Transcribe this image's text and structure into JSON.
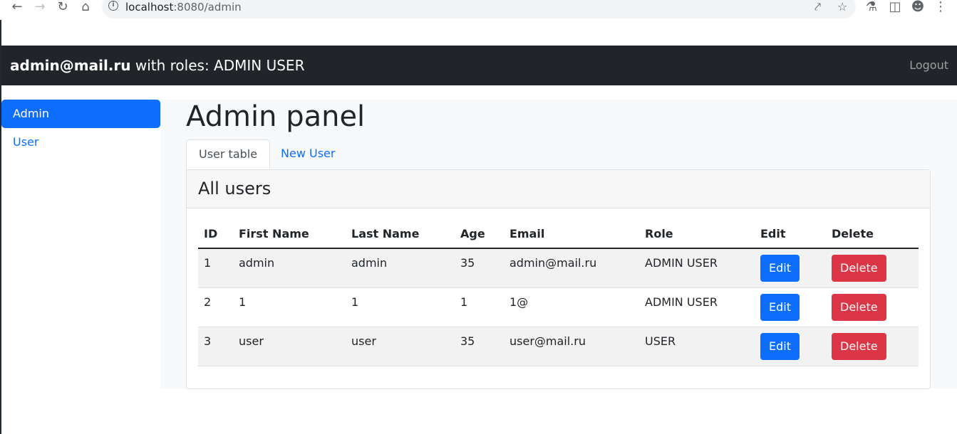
{
  "browser": {
    "url_host": "localhost",
    "url_path": ":8080/admin"
  },
  "navbar": {
    "user_email": "admin@mail.ru",
    "roles_text": " with roles: ADMIN USER",
    "logout_label": "Logout"
  },
  "sidebar": {
    "items": [
      {
        "label": "Admin",
        "active": true
      },
      {
        "label": "User",
        "active": false
      }
    ]
  },
  "main": {
    "title": "Admin panel",
    "tabs": [
      {
        "label": "User table",
        "active": true
      },
      {
        "label": "New User",
        "active": false
      }
    ],
    "card_title": "All users"
  },
  "table": {
    "headers": [
      "ID",
      "First Name",
      "Last Name",
      "Age",
      "Email",
      "Role",
      "Edit",
      "Delete"
    ],
    "edit_label": "Edit",
    "delete_label": "Delete",
    "rows": [
      {
        "id": "1",
        "first_name": "admin",
        "last_name": "admin",
        "age": "35",
        "email": "admin@mail.ru",
        "role": "ADMIN USER"
      },
      {
        "id": "2",
        "first_name": "1",
        "last_name": "1",
        "age": "1",
        "email": "1@",
        "role": "ADMIN USER"
      },
      {
        "id": "3",
        "first_name": "user",
        "last_name": "user",
        "age": "35",
        "email": "user@mail.ru",
        "role": "USER"
      }
    ]
  },
  "colors": {
    "navbar_bg": "#212529",
    "primary": "#0d6efd",
    "danger": "#dc3545"
  }
}
